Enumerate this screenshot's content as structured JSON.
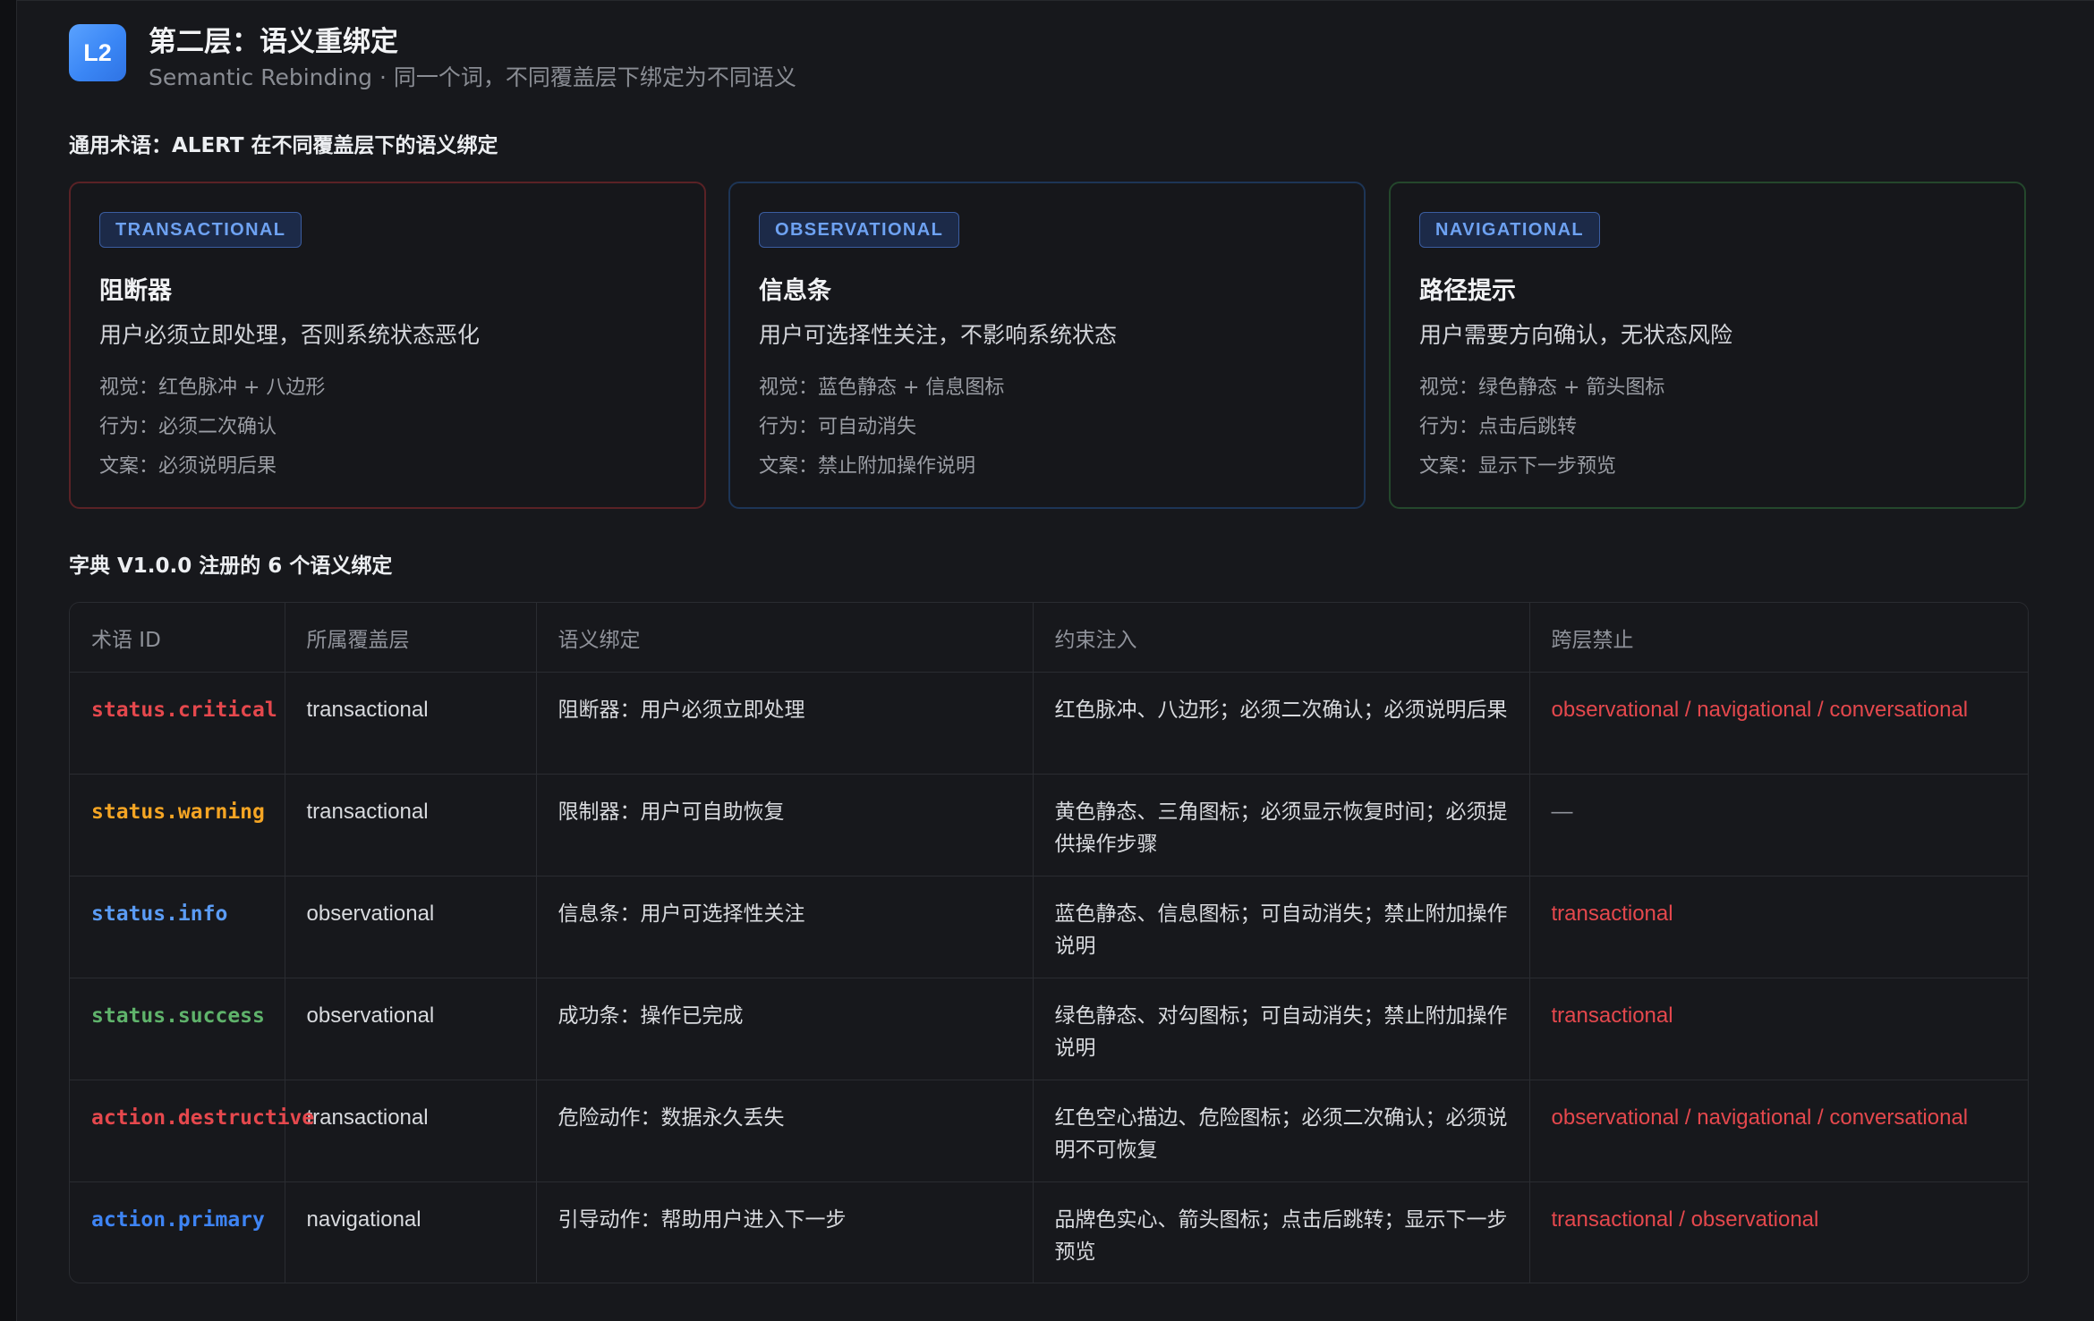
{
  "header": {
    "badge": "L2",
    "title": "第二层：语义重绑定",
    "subtitle": "Semantic Rebinding · 同一个词，不同覆盖层下绑定为不同语义"
  },
  "section1": {
    "title": "通用术语：ALERT 在不同覆盖层下的语义绑定"
  },
  "cards": [
    {
      "tag": "TRANSACTIONAL",
      "title": "阻断器",
      "desc": "用户必须立即处理，否则系统状态恶化",
      "visual": "视觉：红色脉冲 + 八边形",
      "behavior": "行为：必须二次确认",
      "copy": "文案：必须说明后果",
      "border_color": "#5a2226"
    },
    {
      "tag": "OBSERVATIONAL",
      "title": "信息条",
      "desc": "用户可选择性关注，不影响系统状态",
      "visual": "视觉：蓝色静态 + 信息图标",
      "behavior": "行为：可自动消失",
      "copy": "文案：禁止附加操作说明",
      "border_color": "#1d3556"
    },
    {
      "tag": "NAVIGATIONAL",
      "title": "路径提示",
      "desc": "用户需要方向确认，无状态风险",
      "visual": "视觉：绿色静态 + 箭头图标",
      "behavior": "行为：点击后跳转",
      "copy": "文案：显示下一步预览",
      "border_color": "#24472c"
    }
  ],
  "section2": {
    "title": "字典 V1.0.0 注册的 6 个语义绑定"
  },
  "table": {
    "headers": [
      "术语 ID",
      "所属覆盖层",
      "语义绑定",
      "约束注入",
      "跨层禁止"
    ],
    "rows": [
      {
        "id": "status.critical",
        "id_color": "#e5484d",
        "layer": "transactional",
        "binding": "阻断器：用户必须立即处理",
        "constraint": "红色脉冲、八边形；必须二次确认；必须说明后果",
        "ban": "observational / navigational / conversational"
      },
      {
        "id": "status.warning",
        "id_color": "#f5a524",
        "layer": "transactional",
        "binding": "限制器：用户可自助恢复",
        "constraint": "黄色静态、三角图标；必须显示恢复时间；必须提供操作步骤",
        "ban": "—"
      },
      {
        "id": "status.info",
        "id_color": "#5b9cf5",
        "layer": "observational",
        "binding": "信息条：用户可选择性关注",
        "constraint": "蓝色静态、信息图标；可自动消失；禁止附加操作说明",
        "ban": "transactional"
      },
      {
        "id": "status.success",
        "id_color": "#5fb36b",
        "layer": "observational",
        "binding": "成功条：操作已完成",
        "constraint": "绿色静态、对勾图标；可自动消失；禁止附加操作说明",
        "ban": "transactional"
      },
      {
        "id": "action.destructive",
        "id_color": "#e5484d",
        "layer": "transactional",
        "binding": "危险动作：数据永久丢失",
        "constraint": "红色空心描边、危险图标；必须二次确认；必须说明不可恢复",
        "ban": "observational / navigational / conversational"
      },
      {
        "id": "action.primary",
        "id_color": "#3e84f4",
        "layer": "navigational",
        "binding": "引导动作：帮助用户进入下一步",
        "constraint": "品牌色实心、箭头图标；点击后跳转；显示下一步预览",
        "ban": "transactional / observational"
      }
    ]
  }
}
